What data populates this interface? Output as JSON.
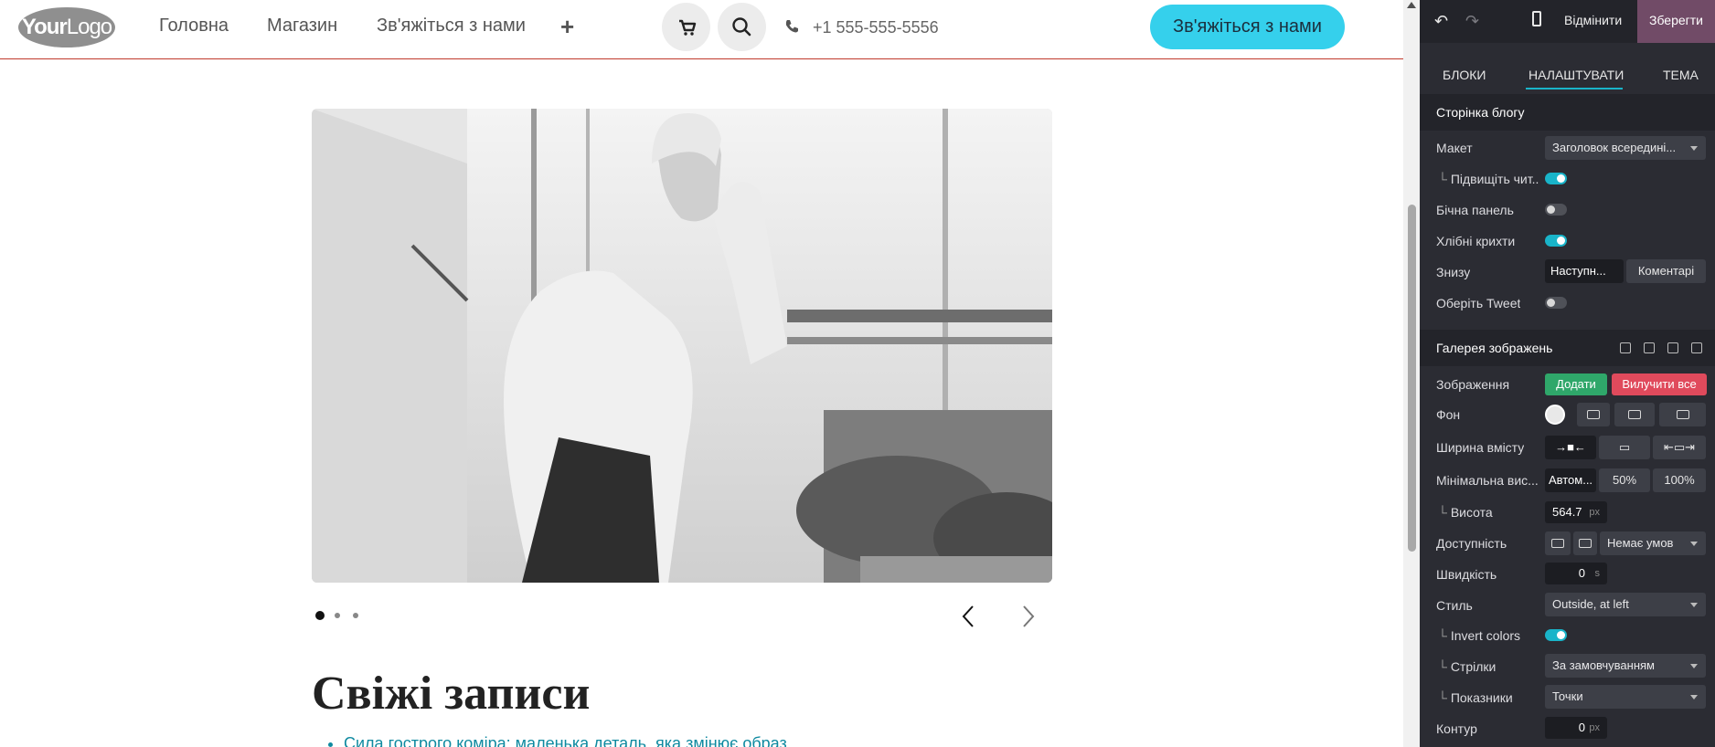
{
  "header": {
    "logo_text_bold": "Your",
    "logo_text_light": "Logo",
    "nav": [
      "Головна",
      "Магазин",
      "Зв'яжіться з нами"
    ],
    "plus_icon": "plus-icon",
    "phone": "+1 555-555-5556",
    "cta_label": "Зв'яжіться з нами",
    "accent_color": "#35d0ec"
  },
  "carousel": {
    "active_index": 0,
    "total": 3
  },
  "content": {
    "section_title": "Свіжі записи",
    "posts": [
      "Сила гострого коміра: маленька деталь, яка змінює образ"
    ]
  },
  "editor": {
    "toolbar": {
      "discard_label": "Відмінити",
      "save_label": "Зберегти",
      "save_color": "#714b67"
    },
    "tabs": [
      "БЛОКИ",
      "НАЛАШТУВАТИ",
      "ТЕМА"
    ],
    "active_tab": "НАЛАШТУВАТИ",
    "blog_page": {
      "title": "Сторінка блогу",
      "layout_label": "Макет",
      "layout_value": "Заголовок всередині...",
      "readability_label": "Підвищіть чит...",
      "readability_on": true,
      "sidebar_label": "Бічна панель",
      "sidebar_on": false,
      "breadcrumbs_label": "Хлібні крихти",
      "breadcrumbs_on": true,
      "bottom_label": "Знизу",
      "bottom_options": [
        "Наступн...",
        "Коментарі"
      ],
      "tweet_label": "Оберіть Tweet",
      "tweet_on": false
    },
    "gallery": {
      "title": "Галерея зображень",
      "images_label": "Зображення",
      "add_label": "Додати",
      "remove_all_label": "Вилучити все",
      "bg_label": "Фон",
      "width_label": "Ширина вмісту",
      "min_height_label": "Мінімальна вис...",
      "min_height_options": [
        "Автом...",
        "50%",
        "100%"
      ],
      "height_label": "Висота",
      "height_value": "564.7",
      "height_unit": "px",
      "visibility_label": "Доступність",
      "visibility_value": "Немає умов",
      "speed_label": "Швидкість",
      "speed_value": "0",
      "speed_unit": "s",
      "style_label": "Стиль",
      "style_value": "Outside, at left",
      "invert_label": "Invert colors",
      "invert_on": true,
      "arrows_label": "Стрілки",
      "arrows_value": "За замовчуванням",
      "indicators_label": "Показники",
      "indicators_value": "Точки",
      "border_label": "Контур",
      "border_value": "0",
      "border_unit": "px"
    }
  }
}
